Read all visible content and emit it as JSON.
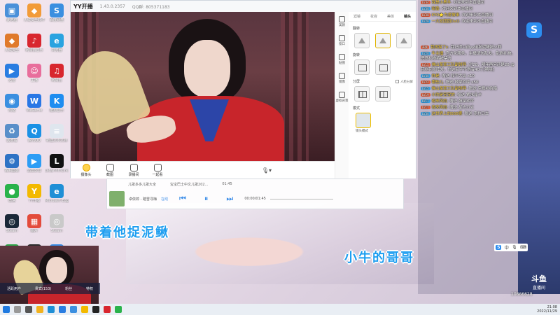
{
  "desktop": {
    "col1": [
      {
        "label": "此电脑",
        "color": "#4a90d9",
        "glyph": "▣"
      },
      {
        "label": "火绒安全",
        "color": "#e07a2b",
        "glyph": "◆"
      },
      {
        "label": "迅雷",
        "color": "#2a7de1",
        "glyph": "▶"
      },
      {
        "label": "网络",
        "color": "#3b8fe0",
        "glyph": "◉"
      },
      {
        "label": "回收站",
        "color": "#5a8fc9",
        "glyph": "♻"
      },
      {
        "label": "控制面板",
        "color": "#2f73c5",
        "glyph": "⚙"
      },
      {
        "label": "微信",
        "color": "#2ab24b",
        "glyph": "●"
      },
      {
        "label": "Steam",
        "color": "#1b2838",
        "glyph": "◎"
      },
      {
        "label": "360",
        "color": "#2ea84a",
        "glyph": "●"
      }
    ],
    "col2": [
      {
        "label": "火绒安全软件",
        "color": "#f29b38",
        "glyph": "◆"
      },
      {
        "label": "网易云音乐",
        "color": "#d8262e",
        "glyph": "♪"
      },
      {
        "label": "主播",
        "color": "#e86e9c",
        "glyph": "☺"
      },
      {
        "label": "WeGame",
        "color": "#2977e5",
        "glyph": "W"
      },
      {
        "label": "腾讯QQ",
        "color": "#1b91e5",
        "glyph": "Q"
      },
      {
        "label": "迅雷影音",
        "color": "#2d9df5",
        "glyph": "▶"
      },
      {
        "label": "YY开播",
        "color": "#f3b900",
        "glyph": "Y"
      },
      {
        "label": "图片",
        "color": "#e34b3b",
        "glyph": "▦"
      },
      {
        "label": "OBS",
        "color": "#2b2b2b",
        "glyph": "◉"
      }
    ],
    "col3": [
      {
        "label": "百度网盘",
        "color": "#3b8fe0",
        "glyph": "S"
      },
      {
        "label": "浏览器",
        "color": "#2aa3e0",
        "glyph": "e"
      },
      {
        "label": "网易云",
        "color": "#d8262e",
        "glyph": "♫"
      },
      {
        "label": "酷狗音乐",
        "color": "#1f8df0",
        "glyph": "K"
      },
      {
        "label": "新建文本文档",
        "color": "#dfe6ee",
        "glyph": "≡"
      },
      {
        "label": "LabyrinthLine",
        "color": "#111",
        "glyph": "L"
      },
      {
        "label": "Microsoft Edge",
        "color": "#1f8fd6",
        "glyph": "e"
      },
      {
        "label": "Steam",
        "color": "#c9c9c9",
        "glyph": "◎"
      },
      {
        "label": "YY",
        "color": "#3a8ee6",
        "glyph": "S"
      }
    ]
  },
  "yy": {
    "logo": "YY开播",
    "version": "1.43.0.2357",
    "qq": "QQ群: 805371183",
    "toolbar": [
      {
        "label": "摄像头",
        "active": true
      },
      {
        "label": "截图",
        "active": false
      },
      {
        "label": "录播间",
        "active": false
      },
      {
        "label": "一起看",
        "active": false
      }
    ],
    "side": [
      {
        "label": "美颜"
      },
      {
        "label": "窗口"
      },
      {
        "label": "贴图"
      },
      {
        "label": "镜像"
      },
      {
        "label": "虚拟背景"
      }
    ],
    "panel": {
      "tabs": [
        "滤镜",
        "妆容",
        "美体",
        "镜头"
      ],
      "active_tab": "镜头",
      "sections": {
        "flip": "翻转",
        "rotate": "旋转",
        "split": "分屏",
        "person_split": "人脸分屏",
        "mode": "模式",
        "mode_btn": "镜头模式"
      }
    }
  },
  "music": {
    "row1_a": "儿歌多多儿歌大全",
    "row1_b": "宝宝巴士中文儿歌202...",
    "row1_time": "01:45",
    "song": "卓依婷 - 踏雪寻梅",
    "tag": "在线",
    "time": "00:00/01:45"
  },
  "overlay": {
    "subtitle1": "带着他捉泥鳅",
    "subtitle2": "小牛的哥哥"
  },
  "chat": {
    "messages": [
      {
        "badge": "LV34",
        "nick": "我是小黑羊",
        "text": "欢迎来到本直播间"
      },
      {
        "badge": "LV30",
        "nick": "暗香",
        "text": "欢迎来到本直播间"
      },
      {
        "badge": "LV38",
        "nick": "KYO⭐为爱做事",
        "text": "欢迎来到本直播间"
      },
      {
        "badge": "LV28",
        "nick": "一大宏团团OvO",
        "text": "欢迎来到本直播间"
      },
      {
        "badge": "贵族",
        "nick": "我闹猫了k",
        "text": "我记得以前yy用捉泥鳅挺火啊"
      },
      {
        "badge": "LV20",
        "nick": "牛主播",
        "text": "官方化服务，主播请勿乱发，乱刷礼物，恶意礼物将被禁言"
      },
      {
        "badge": "LV15",
        "nick": "佛山某某工队副领导",
        "text": "对28，明年再问还是28 @花非花那阵发，你这名字不得有40了[嘻嘻]"
      },
      {
        "badge": "LV40",
        "nick": "你是",
        "text": "赠送 和字犬瓜 x10"
      },
      {
        "badge": "LV22",
        "nick": "哪些儿",
        "text": "赠送 鼓掌欢呼 x50"
      },
      {
        "badge": "LV15",
        "nick": "佛山某某工队副领导",
        "text": "赠送 空投补给箱"
      },
      {
        "badge": "LV19",
        "nick": "小的是宝宝的",
        "text": "赠送 紫水晶卡"
      },
      {
        "badge": "LV17",
        "nick": "夜来风雨",
        "text": "赠送 鼓掌欢呼"
      },
      {
        "badge": "LV17",
        "nick": "夜来风雨",
        "text": "赠送 星光万丈"
      },
      {
        "badge": "LV30",
        "nick": "这世界上的666哪",
        "text": "赠送 克拉马车"
      }
    ],
    "footer": [
      "活跃用户",
      "贵宾(153)",
      "粉丝",
      "特权"
    ]
  },
  "ime": {
    "s": "S",
    "mode": "中"
  },
  "brand": {
    "name": "斗鱼",
    "sub": "直播间",
    "room_id": "10866628"
  },
  "taskbar": {
    "time": "21:08",
    "date": "2022/11/29"
  }
}
